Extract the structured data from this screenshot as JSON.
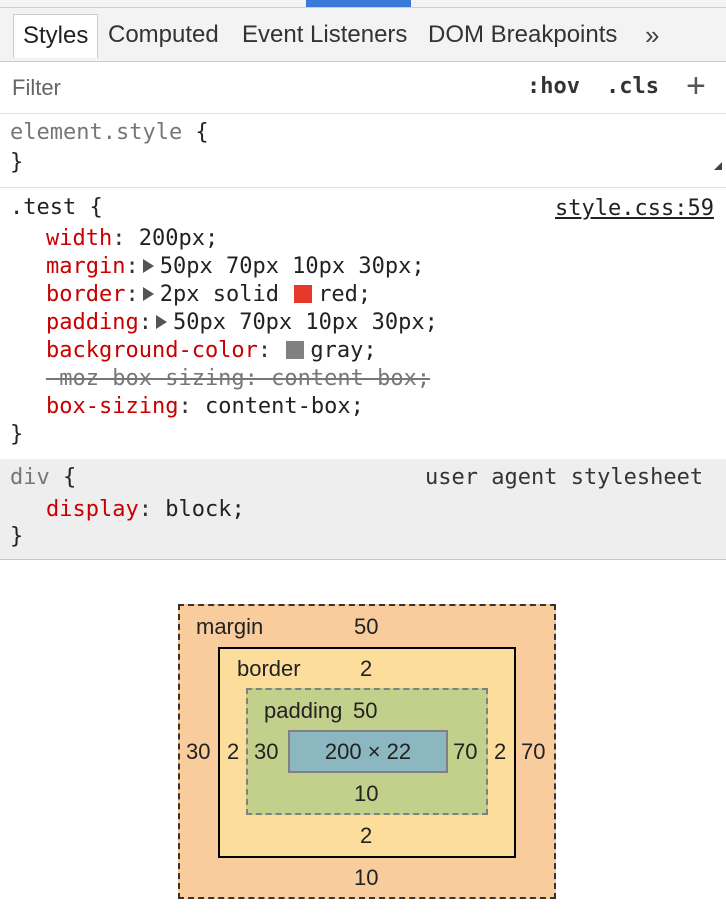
{
  "tabs": {
    "styles": "Styles",
    "computed": "Computed",
    "event_listeners": "Event Listeners",
    "dom_breakpoints": "DOM Breakpoints",
    "more": "»"
  },
  "filter": {
    "placeholder": "Filter",
    "hov": ":hov",
    "cls": ".cls",
    "add": "+"
  },
  "rules": {
    "element_style": {
      "selector": "element.style",
      "open": " {",
      "close": "}"
    },
    "test": {
      "selector": ".test",
      "open": " {",
      "close": "}",
      "source": "style.css:59",
      "declarations": {
        "width": {
          "prop": "width",
          "value": "200px;"
        },
        "margin": {
          "prop": "margin",
          "value": "50px 70px 10px 30px;"
        },
        "border": {
          "prop": "border",
          "value_pre": "2px solid ",
          "value_post": "red;",
          "swatch": "#e8382c"
        },
        "padding": {
          "prop": "padding",
          "value": "50px 70px 10px 30px;"
        },
        "background_color": {
          "prop": "background-color",
          "value": "gray;",
          "swatch": "#808080"
        },
        "moz_box_sizing": {
          "text": "-moz-box-sizing: content-box;"
        },
        "box_sizing": {
          "prop": "box-sizing",
          "value": "content-box;"
        }
      }
    },
    "div": {
      "selector": "div",
      "open": " {",
      "close": "}",
      "source": "user agent stylesheet",
      "declarations": {
        "display": {
          "prop": "display",
          "value": "block;"
        }
      }
    }
  },
  "box_model": {
    "margin_label": "margin",
    "border_label": "border",
    "padding_label": "padding",
    "margin": {
      "top": "50",
      "right": "70",
      "bottom": "10",
      "left": "30"
    },
    "border": {
      "top": "2",
      "right": "2",
      "bottom": "2",
      "left": "2"
    },
    "padding": {
      "top": "50",
      "right": "70",
      "bottom": "10",
      "left": "30"
    },
    "content": "200 × 22",
    "colors": {
      "margin": "#f9cc9d",
      "border": "#fddd9b",
      "padding": "#c3d08b",
      "content": "#8cb6c0"
    }
  }
}
